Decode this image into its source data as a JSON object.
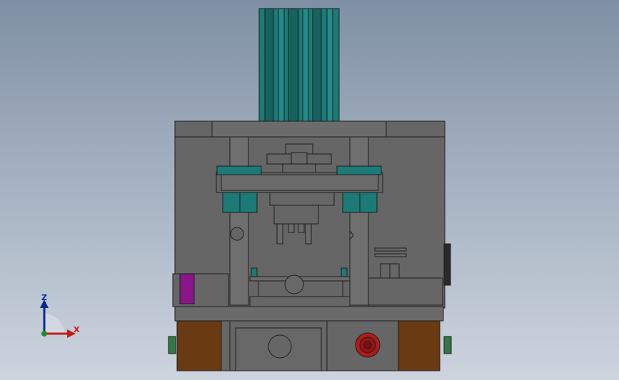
{
  "viewport": {
    "background_top": "#7f90a4",
    "background_bottom": "#cdd4de"
  },
  "model": {
    "body_color": "#666666",
    "edge_color": "#1e1e1e",
    "teal_color": "#1c7a77",
    "brown_color": "#6a3a12",
    "purple_color": "#8a178a",
    "red_color": "#b21a1a",
    "green_color": "#2f7a43"
  },
  "triad": {
    "z_label": "Z",
    "x_label": "X",
    "z_color": "#0a2a8a",
    "x_color": "#c61b1b"
  }
}
